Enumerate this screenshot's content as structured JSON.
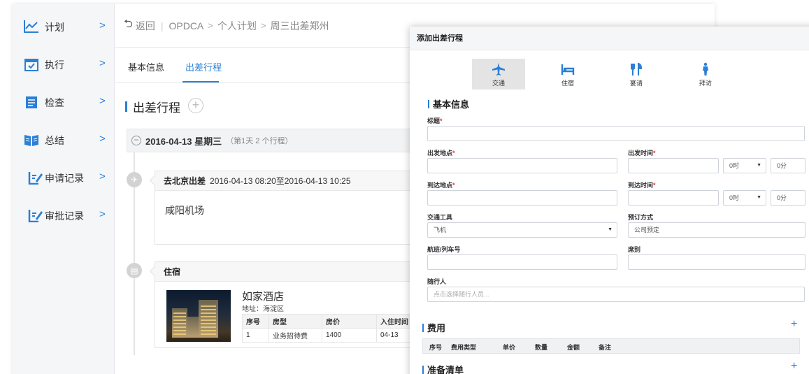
{
  "sidebar": {
    "items": [
      {
        "label": "计划",
        "icon": "line-chart-icon"
      },
      {
        "label": "执行",
        "icon": "calendar-check-icon"
      },
      {
        "label": "检查",
        "icon": "clipboard-list-icon"
      },
      {
        "label": "总结",
        "icon": "book-open-icon"
      },
      {
        "label": "申请记录",
        "icon": "edit-record-icon"
      },
      {
        "label": "审批记录",
        "icon": "edit-record-icon"
      }
    ],
    "chevron": ">"
  },
  "breadcrumb": {
    "back_label": "返回",
    "items": [
      "OPDCA",
      "个人计划",
      "周三出差郑州"
    ]
  },
  "tabs": [
    {
      "label": "基本信息",
      "active": false
    },
    {
      "label": "出差行程",
      "active": true
    }
  ],
  "itinerary": {
    "title": "出差行程",
    "day": {
      "date": "2016-04-13 星期三",
      "summary": "（第1天 2 个行程）"
    },
    "flight": {
      "head_bold": "去北京出差",
      "head_time": "2016-04-13 08:20至2016-04-13 10:25",
      "place": "咸阳机场"
    },
    "lodging": {
      "head_bold": "住宿",
      "hotel_name": "如家酒店",
      "address": "地址：海淀区",
      "columns": [
        "序号",
        "房型",
        "房价",
        "入住时间"
      ],
      "rows": [
        [
          "1",
          "业务招待费",
          "1400",
          "04-13"
        ]
      ]
    }
  },
  "modal": {
    "title": "添加出差行程",
    "type_tabs": [
      {
        "label": "交通",
        "icon": "airplane-icon",
        "active": true
      },
      {
        "label": "住宿",
        "icon": "bed-icon",
        "active": false
      },
      {
        "label": "宴请",
        "icon": "fork-knife-icon",
        "active": false
      },
      {
        "label": "拜访",
        "icon": "person-visit-icon",
        "active": false
      }
    ],
    "basic_section": "基本信息",
    "labels": {
      "title": "标题",
      "depart_place": "出发地点",
      "depart_time": "出发时间",
      "arrive_place": "到达地点",
      "arrive_time": "到达时间",
      "transport": "交通工具",
      "booking": "预订方式",
      "flight_no": "航班/列车号",
      "seat": "席别",
      "companions": "随行人"
    },
    "required_mark": "*",
    "hour_default": "0时",
    "minute_default": "0分",
    "transport_value": "飞机",
    "booking_value": "公司预定",
    "companions_placeholder": "点击选择随行人员...",
    "fee_section": "费用",
    "fee_columns": [
      "序号",
      "费用类型",
      "单价",
      "数量",
      "金额",
      "备注"
    ],
    "prep_section": "准备清单",
    "add_symbol": "+"
  },
  "colors": {
    "accent": "#2a7fd6",
    "required": "#e33333"
  }
}
